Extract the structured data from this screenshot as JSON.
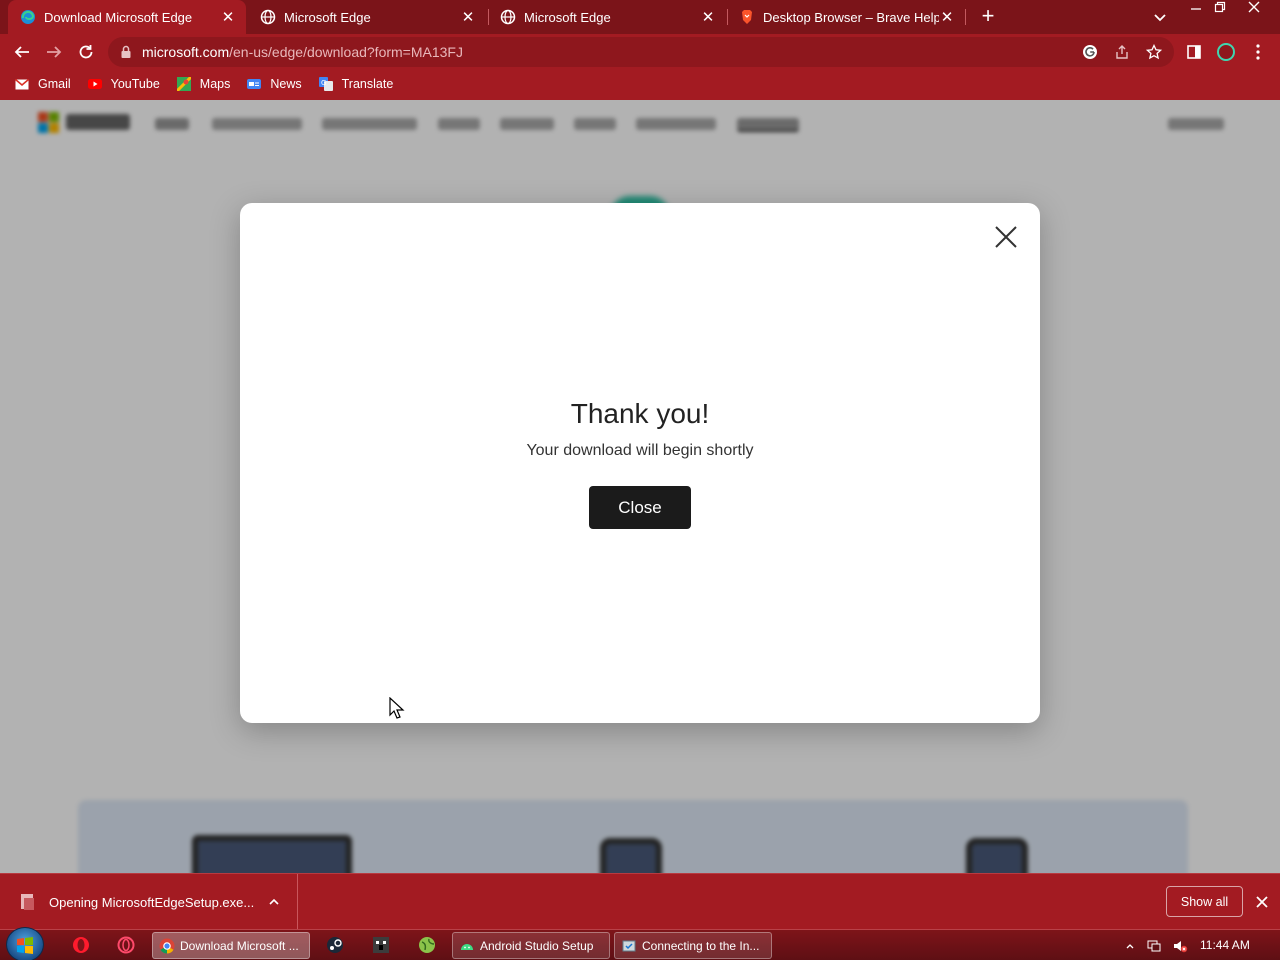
{
  "browser": {
    "tabs": [
      {
        "title": "Download Microsoft Edge",
        "icon": "edge-icon",
        "active": true
      },
      {
        "title": "Microsoft Edge",
        "icon": "globe-icon",
        "active": false
      },
      {
        "title": "Microsoft Edge",
        "icon": "globe-icon",
        "active": false
      },
      {
        "title": "Desktop Browser – Brave Help Ce",
        "icon": "brave-icon",
        "active": false
      }
    ],
    "new_tab": "+",
    "url_host": "microsoft.com",
    "url_path": "/en-us/edge/download?form=MA13FJ",
    "bookmarks": [
      {
        "label": "Gmail",
        "icon": "gmail-icon"
      },
      {
        "label": "YouTube",
        "icon": "youtube-icon"
      },
      {
        "label": "Maps",
        "icon": "maps-icon"
      },
      {
        "label": "News",
        "icon": "news-icon"
      },
      {
        "label": "Translate",
        "icon": "translate-icon"
      }
    ],
    "theme_color": "#a31b22",
    "tabstrip_color": "#7b1419"
  },
  "dialog": {
    "title": "Thank you!",
    "subtitle": "Your download will begin shortly",
    "close_label": "Close"
  },
  "download_shelf": {
    "item_text": "Opening MicrosoftEdgeSetup.exe...",
    "show_all": "Show all"
  },
  "taskbar": {
    "tasks": [
      {
        "label": "Download Microsoft ...",
        "icon": "chrome-icon",
        "active": true
      },
      {
        "label": "Android Studio Setup",
        "icon": "android-studio-icon",
        "active": false
      },
      {
        "label": "Connecting to the In...",
        "icon": "installer-icon",
        "active": false
      }
    ],
    "time": "11:44 AM"
  }
}
